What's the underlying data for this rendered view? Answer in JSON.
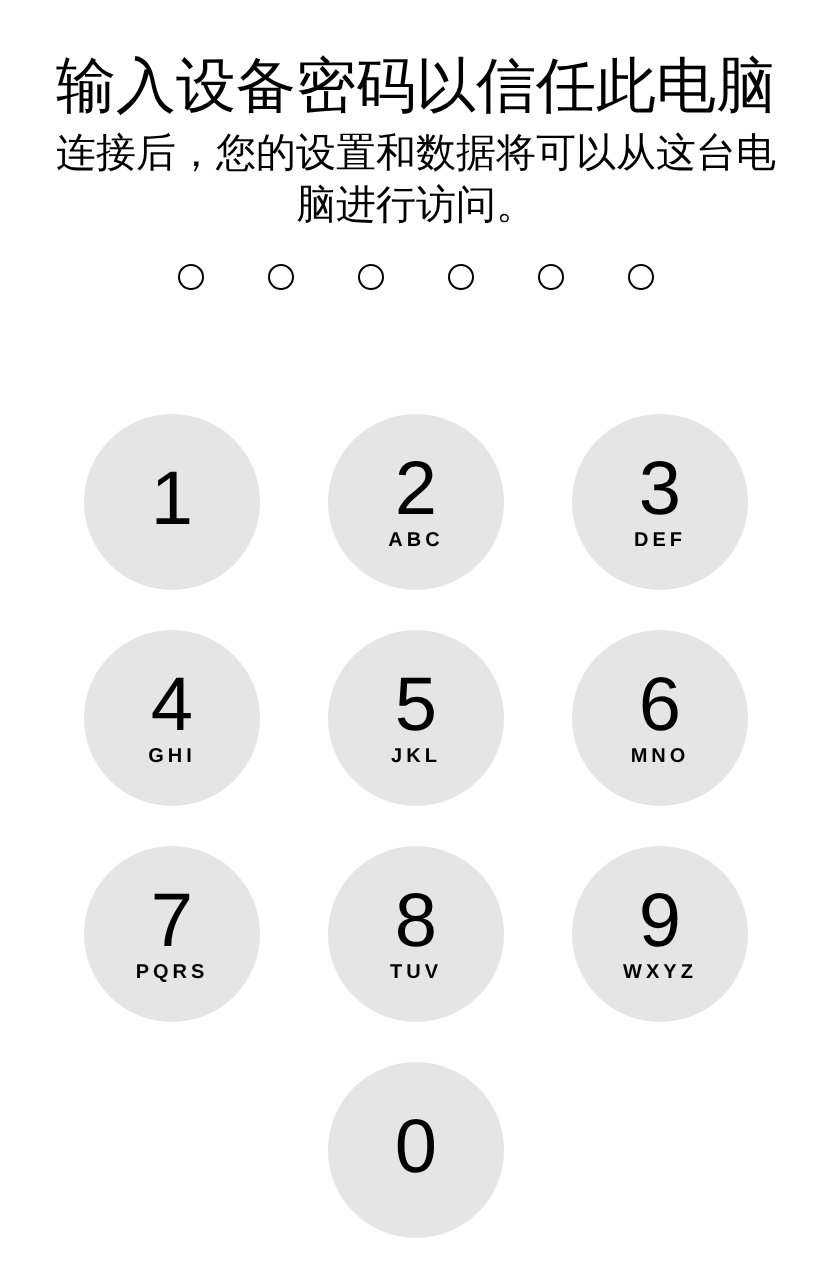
{
  "title": "输入设备密码以信任此电脑",
  "message": "连接后，您的设置和数据将可以从这台电脑进行访问。",
  "passcode_dots": [
    {
      "filled": false
    },
    {
      "filled": false
    },
    {
      "filled": false
    },
    {
      "filled": false
    },
    {
      "filled": false
    },
    {
      "filled": false
    }
  ],
  "keypad": [
    {
      "digit": "1"
    },
    {
      "digit": "2",
      "letters": "ABC"
    },
    {
      "digit": "3",
      "letters": "DEF"
    },
    {
      "digit": "4",
      "letters": "GHI"
    },
    {
      "digit": "5",
      "letters": "JKL"
    },
    {
      "digit": "6",
      "letters": "MNO"
    },
    {
      "digit": "7",
      "letters": "PQRS"
    },
    {
      "digit": "8",
      "letters": "TUV"
    },
    {
      "digit": "9",
      "letters": "WXYZ"
    },
    {
      "digit": "0"
    }
  ]
}
